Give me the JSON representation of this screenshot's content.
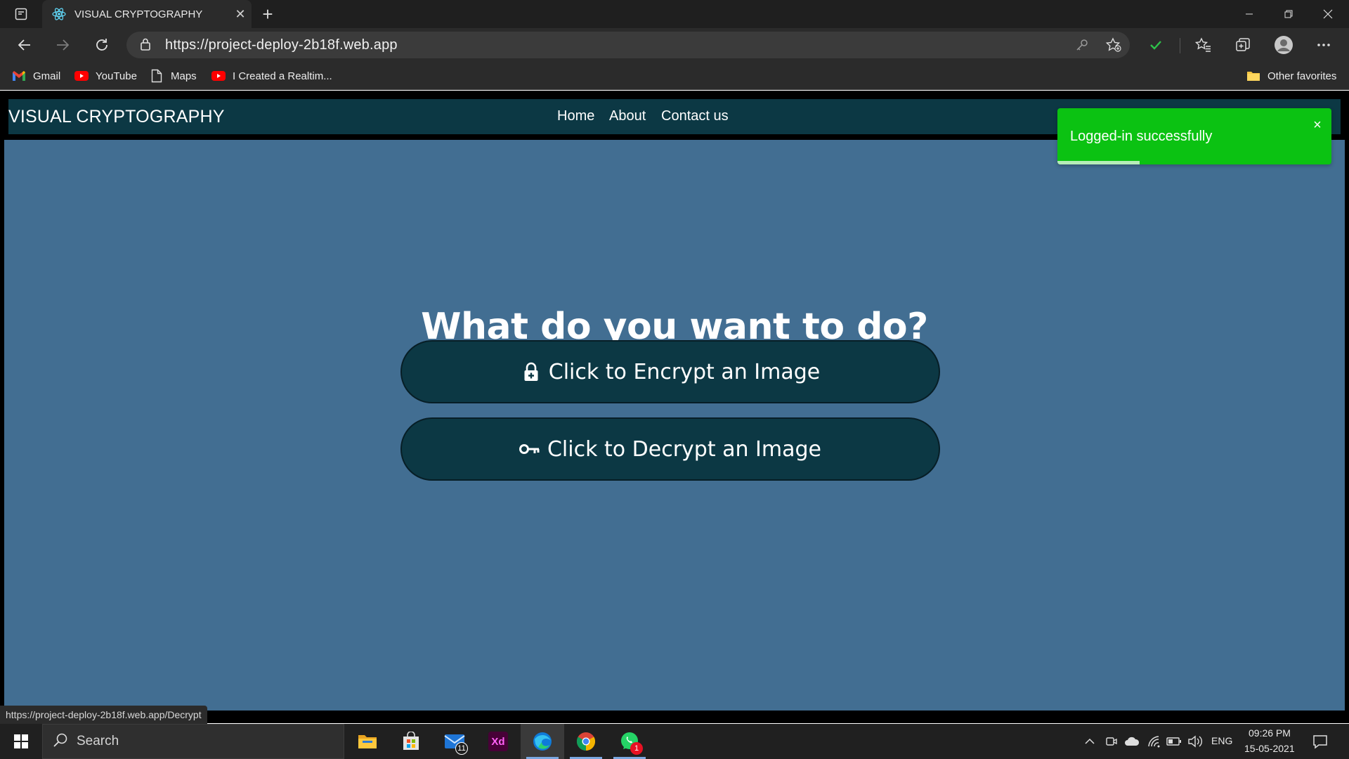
{
  "browser": {
    "tab_title": "VISUAL CRYPTOGRAPHY",
    "url": "https://project-deploy-2b18f.web.app",
    "bookmarks": [
      {
        "label": "Gmail",
        "icon": "gmail-icon"
      },
      {
        "label": "YouTube",
        "icon": "youtube-icon"
      },
      {
        "label": "Maps",
        "icon": "page-icon"
      },
      {
        "label": "I Created a Realtim...",
        "icon": "youtube-icon"
      }
    ],
    "other_favorites": "Other favorites",
    "status_url": "https://project-deploy-2b18f.web.app/Decrypt"
  },
  "site": {
    "brand": "VISUAL CRYPTOGRAPHY",
    "nav": [
      "Home",
      "About",
      "Contact us"
    ],
    "heading": "What do you want to do?",
    "encrypt_label": "Click to Encrypt an Image",
    "decrypt_label": "Click to Decrypt an Image",
    "colors": {
      "nav_bg": "#0c3844",
      "main_bg": "#426e92",
      "button_bg": "#0c3844",
      "toast_bg": "#0bc212"
    }
  },
  "toast": {
    "message": "Logged-in successfully",
    "close": "×",
    "progress": 0.3
  },
  "taskbar": {
    "search_label": "Search",
    "mail_badge": "11",
    "whatsapp_badge": "1",
    "xd_label": "Xd",
    "lang": "ENG",
    "time": "09:26 PM",
    "date": "15-05-2021"
  }
}
